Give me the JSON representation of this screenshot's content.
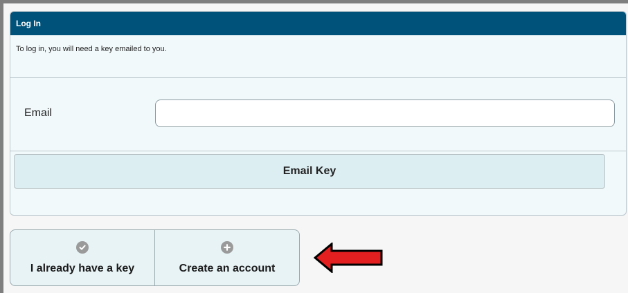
{
  "panel": {
    "title": "Log In",
    "info": "To log in, you will need a key emailed to you.",
    "email_label": "Email",
    "email_value": "",
    "email_key_label": "Email Key"
  },
  "options": [
    {
      "label": "I already have a key",
      "icon": "check-circle-icon"
    },
    {
      "label": "Create an account",
      "icon": "plus-circle-icon"
    }
  ],
  "colors": {
    "header": "#00527a",
    "panel_bg": "#f2f9fb",
    "button_bg": "#ddeef2",
    "arrow_fill": "#e31f1f"
  }
}
